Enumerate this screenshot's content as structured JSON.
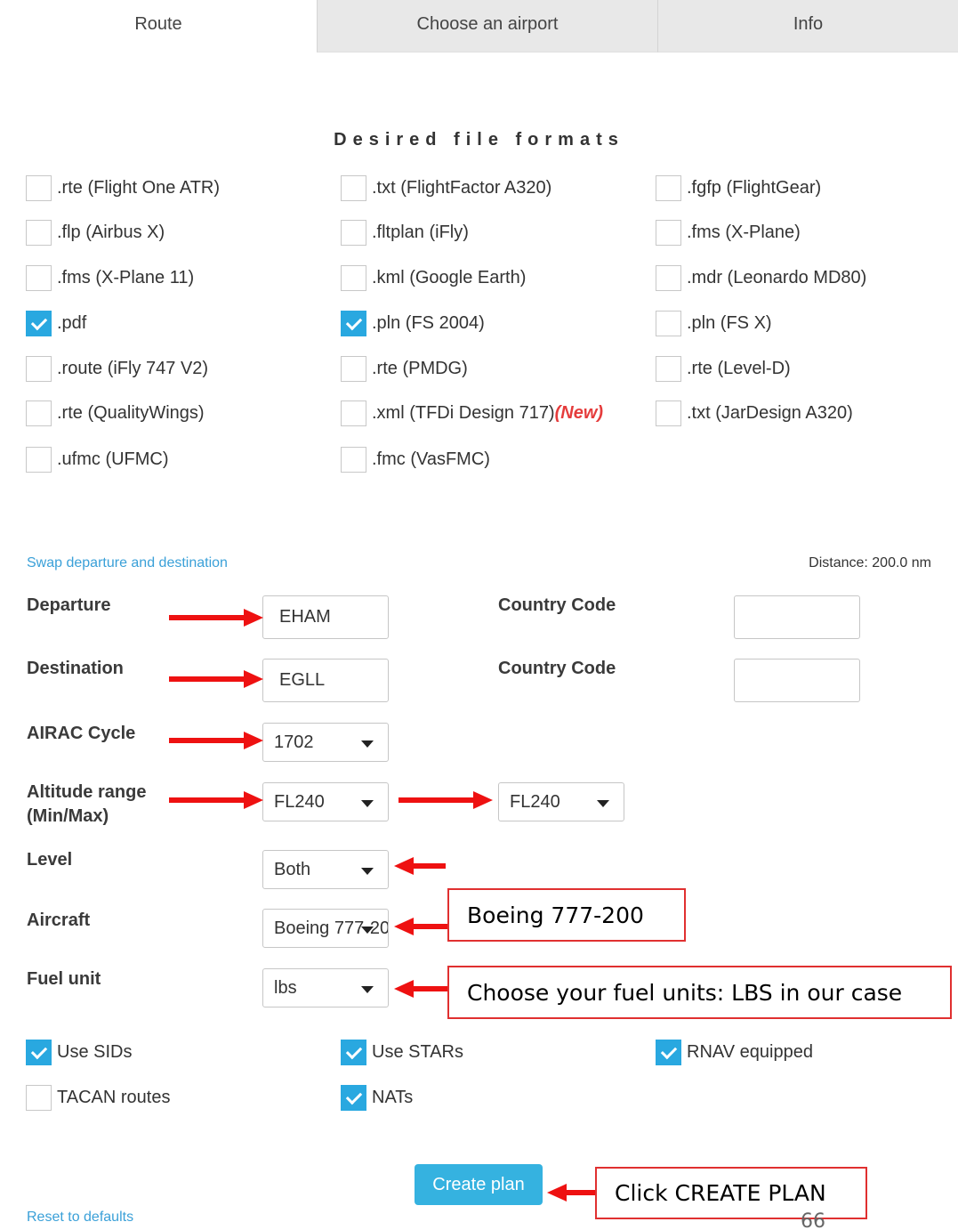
{
  "tabs": [
    {
      "label": "Route"
    },
    {
      "label": "Choose an airport"
    },
    {
      "label": "Info"
    }
  ],
  "formats_title": "Desired file formats",
  "formats": [
    {
      "label": ".rte (Flight One ATR)",
      "checked": false
    },
    {
      "label": ".txt (FlightFactor A320)",
      "checked": false
    },
    {
      "label": ".fgfp (FlightGear)",
      "checked": false
    },
    {
      "label": ".flp (Airbus X)",
      "checked": false
    },
    {
      "label": ".fltplan (iFly)",
      "checked": false
    },
    {
      "label": ".fms (X-Plane)",
      "checked": false
    },
    {
      "label": ".fms (X-Plane 11)",
      "checked": false
    },
    {
      "label": ".kml (Google Earth)",
      "checked": false
    },
    {
      "label": ".mdr (Leonardo MD80)",
      "checked": false
    },
    {
      "label": ".pdf",
      "checked": true
    },
    {
      "label": ".pln (FS 2004)",
      "checked": true
    },
    {
      "label": ".pln (FS X)",
      "checked": false
    },
    {
      "label": ".route (iFly 747 V2)",
      "checked": false
    },
    {
      "label": ".rte (PMDG)",
      "checked": false
    },
    {
      "label": ".rte (Level-D)",
      "checked": false
    },
    {
      "label": ".rte (QualityWings)",
      "checked": false
    },
    {
      "label": ".xml (TFDi Design 717)",
      "checked": false,
      "badge": "(New)"
    },
    {
      "label": ".txt (JarDesign A320)",
      "checked": false
    },
    {
      "label": ".ufmc (UFMC)",
      "checked": false
    },
    {
      "label": ".fmc (VasFMC)",
      "checked": false
    }
  ],
  "swap_link": "Swap departure and destination",
  "distance": "Distance: 200.0 nm",
  "form": {
    "departure_label": "Departure",
    "departure_value": "EHAM",
    "destination_label": "Destination",
    "destination_value": "EGLL",
    "country_code_label": "Country Code",
    "country_code_dep": "",
    "country_code_dest": "",
    "airac_label": "AIRAC Cycle",
    "airac_value": "1702",
    "altitude_label_1": "Altitude range",
    "altitude_label_2": "(Min/Max)",
    "altitude_min": "FL240",
    "altitude_max": "FL240",
    "level_label": "Level",
    "level_value": "Both",
    "aircraft_label": "Aircraft",
    "aircraft_value": "Boeing 777-200",
    "fuel_label": "Fuel unit",
    "fuel_value": "lbs"
  },
  "options": [
    {
      "label": "Use SIDs",
      "checked": true
    },
    {
      "label": "Use STARs",
      "checked": true
    },
    {
      "label": "RNAV equipped",
      "checked": true
    },
    {
      "label": "TACAN routes",
      "checked": false
    },
    {
      "label": "NATs",
      "checked": true
    }
  ],
  "create_button": "Create plan",
  "reset_link": "Reset to defaults",
  "annotations": {
    "aircraft_note": "Boeing 777-200",
    "fuel_note": "Choose your fuel units: LBS in our case",
    "create_note": "Click CREATE PLAN"
  },
  "page_number": "66",
  "colors": {
    "accent": "#29a8e0",
    "annotation": "#ee1111",
    "new_badge": "#e53c3c"
  }
}
